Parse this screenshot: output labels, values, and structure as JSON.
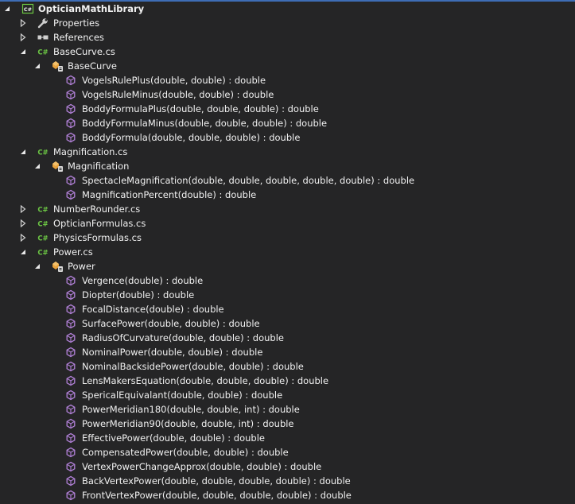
{
  "tree": {
    "project": "OpticianMathLibrary",
    "properties": "Properties",
    "references": "References",
    "files": [
      {
        "name": "BaseCurve.cs",
        "class": "BaseCurve",
        "methods": [
          "VogelsRulePlus(double, double) : double",
          "VogelsRuleMinus(double, double) : double",
          "BoddyFormulaPlus(double, double, double) : double",
          "BoddyFormulaMinus(double, double, double) : double",
          "BoddyFormula(double, double, double) : double"
        ]
      },
      {
        "name": "Magnification.cs",
        "class": "Magnification",
        "methods": [
          "SpectacleMagnification(double, double, double, double, double) : double",
          "MagnificationPercent(double) : double"
        ]
      },
      {
        "name": "NumberRounder.cs"
      },
      {
        "name": "OpticianFormulas.cs"
      },
      {
        "name": "PhysicsFormulas.cs"
      },
      {
        "name": "Power.cs",
        "class": "Power",
        "methods": [
          "Vergence(double) : double",
          "Diopter(double) : double",
          "FocalDistance(double) : double",
          "SurfacePower(double, double) : double",
          "RadiusOfCurvature(double, double) : double",
          "NominalPower(double, double) : double",
          "NominalBacksidePower(double, double) : double",
          "LensMakersEquation(double, double, double) : double",
          "SpericalEquivalant(double, double) : double",
          "PowerMeridian180(double, double, int) : double",
          "PowerMeridian90(double, double, int) : double",
          "EffectivePower(double, double) : double",
          "CompensatedPower(double, double) : double",
          "VertexPowerChangeApprox(double, double) : double",
          "BackVertexPower(double, double, double, double) : double",
          "FrontVertexPower(double, double, double, double) : double"
        ]
      }
    ]
  },
  "colors": {
    "background": "#252526",
    "text": "#f1f1f1",
    "csharp_green": "#6cc644",
    "method_purple": "#b180d7",
    "class_orange": "#e8a23c",
    "accent_blue": "#3e6db5"
  },
  "icons": {
    "expanded": "chevron-expanded-icon",
    "collapsed": "chevron-collapsed-icon",
    "project": "csharp-project-icon",
    "properties": "wrench-icon",
    "references": "references-icon",
    "file": "csharp-file-icon",
    "class": "class-icon",
    "method": "method-cube-icon"
  }
}
